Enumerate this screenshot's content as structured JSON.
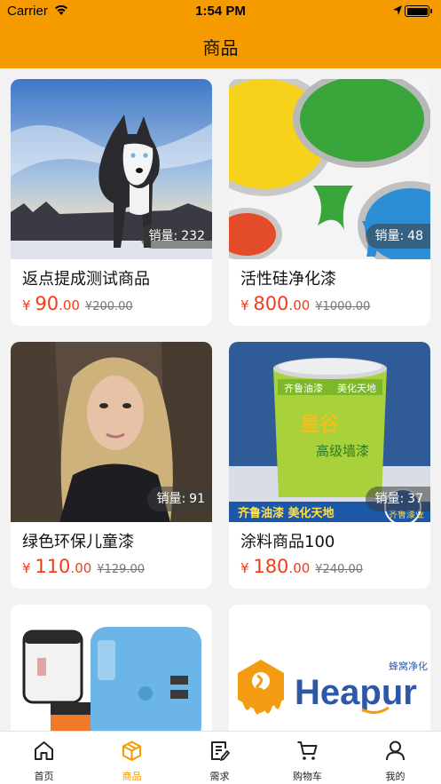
{
  "status_bar": {
    "carrier": "Carrier",
    "time": "1:54 PM"
  },
  "header": {
    "title": "商品"
  },
  "products": [
    {
      "name": "返点提成测试商品",
      "sales_label": "销量:",
      "sales": "232",
      "currency": "¥",
      "price_int": "90",
      "price_dec": ".00",
      "old_price": "¥200.00",
      "image": "husky-dog"
    },
    {
      "name": "活性硅净化漆",
      "sales_label": "销量:",
      "sales": "48",
      "currency": "¥",
      "price_int": "800",
      "price_dec": ".00",
      "old_price": "¥1000.00",
      "image": "paint-cans"
    },
    {
      "name": "绿色环保儿童漆",
      "sales_label": "销量:",
      "sales": "91",
      "currency": "¥",
      "price_int": "110",
      "price_dec": ".00",
      "old_price": "¥129.00",
      "image": "portrait-woman"
    },
    {
      "name": "涂料商品100",
      "sales_label": "销量:",
      "sales": "37",
      "currency": "¥",
      "price_int": "180",
      "price_dec": ".00",
      "old_price": "¥240.00",
      "image": "paint-bucket"
    },
    {
      "name": "",
      "image": "travel-adapter"
    },
    {
      "name": "",
      "image": "heapur-logo"
    }
  ],
  "image_text": {
    "bucket_brand": "齐鲁油漆",
    "bucket_sub": "美化天地",
    "bucket_product": "高级墙漆",
    "bucket_logo": "星谷",
    "bucket_banner": "齐鲁油漆 美化天地",
    "bucket_badge": "齐鲁漆业",
    "heapur_word": "Heapur",
    "heapur_cn": "蜂窝净化"
  },
  "tabbar": {
    "tabs": [
      {
        "label": "首页",
        "icon": "home-icon",
        "active": false
      },
      {
        "label": "商品",
        "icon": "box-icon",
        "active": true
      },
      {
        "label": "需求",
        "icon": "document-edit-icon",
        "active": false
      },
      {
        "label": "购物车",
        "icon": "cart-icon",
        "active": false
      },
      {
        "label": "我的",
        "icon": "person-icon",
        "active": false
      }
    ]
  },
  "colors": {
    "accent": "#f59b00",
    "price": "#f23c1a",
    "background": "#f2f2f2"
  }
}
